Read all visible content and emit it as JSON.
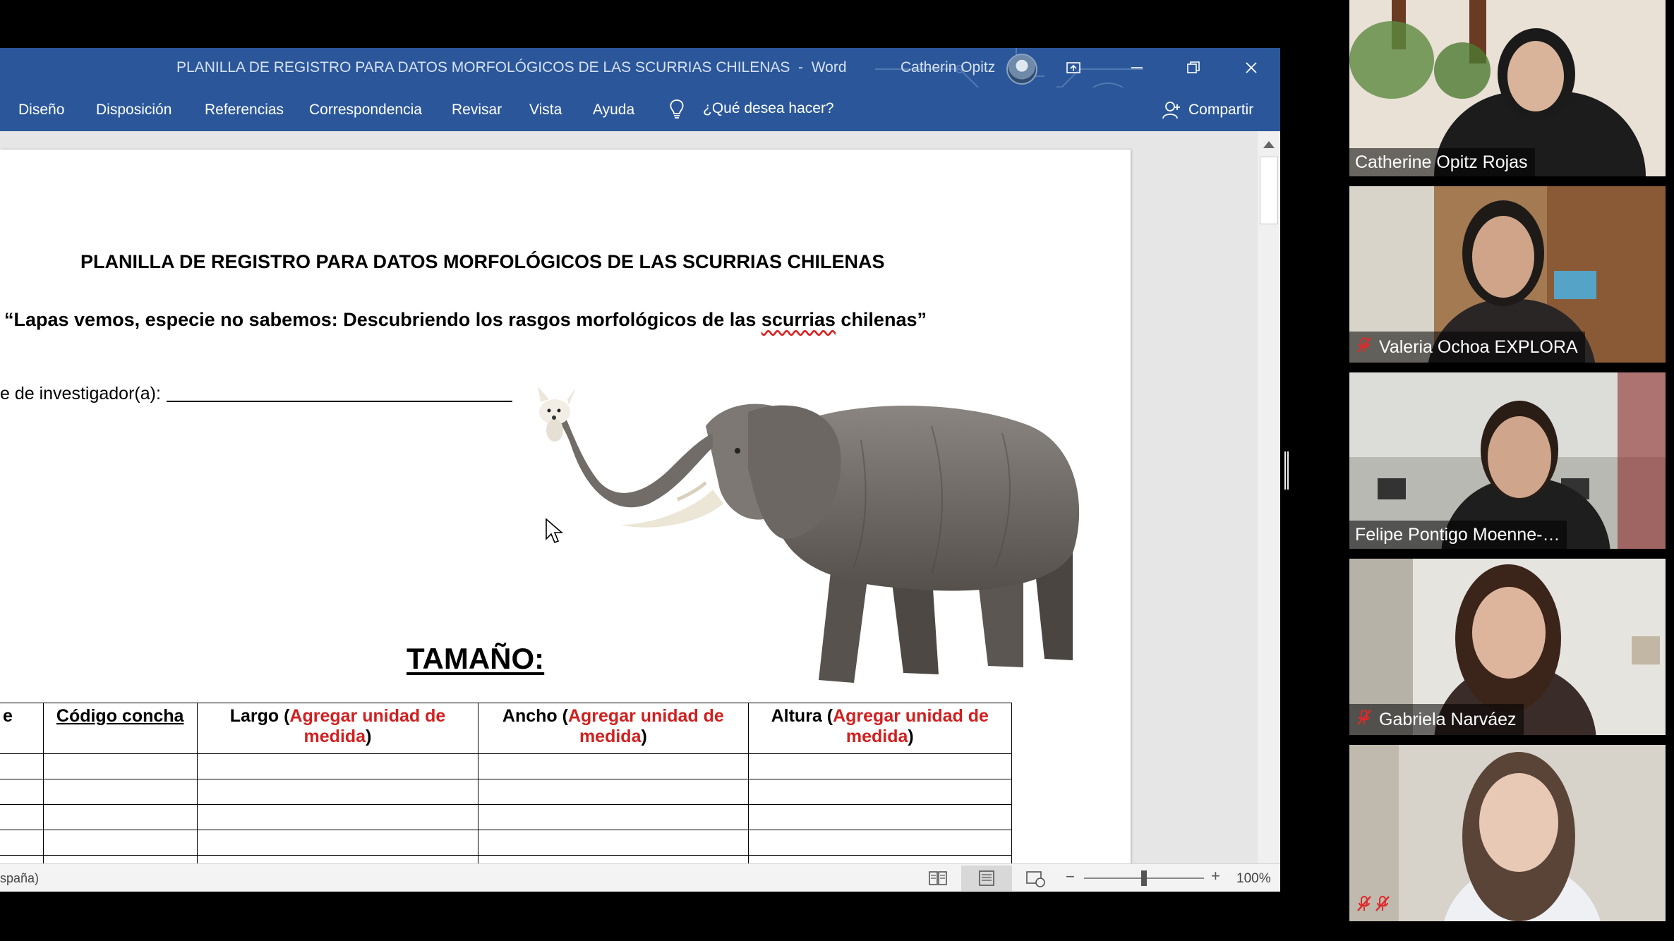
{
  "word": {
    "title": "PLANILLA DE REGISTRO PARA DATOS MORFOLÓGICOS DE LAS SCURRIAS CHILENAS  -  Word",
    "user_name": "Catherin Opitz",
    "menu": [
      "Diseño",
      "Disposición",
      "Referencias",
      "Correspondencia",
      "Revisar",
      "Vista",
      "Ayuda"
    ],
    "tell_me": "¿Qué desea hacer?",
    "share_label": "Compartir",
    "status_language": "spaña)",
    "zoom_minus": "−",
    "zoom_plus": "+",
    "zoom_level": "100%",
    "zoom_fraction": 0.5
  },
  "document": {
    "heading": "PLANILLA DE REGISTRO PARA DATOS MORFOLÓGICOS DE LAS SCURRIAS CHILENAS",
    "subtitle_before": "“Lapas vemos, especie no sabemos: Descubriendo los rasgos morfológicos de las ",
    "subtitle_spell": "scurrias",
    "subtitle_after": " chilenas”",
    "investigator_label": "e de investigador(a):",
    "section_title": "TAMAÑO:",
    "table": {
      "col0_fragment": "e",
      "col_code": "Código concha",
      "cols": [
        {
          "label": "Largo (",
          "red": "Agregar unidad de",
          "red2": "medida",
          "close": ")"
        },
        {
          "label": "Ancho (",
          "red": "Agregar unidad de",
          "red2": "medida",
          "close": ")"
        },
        {
          "label": "Altura (",
          "red": "Agregar unidad de",
          "red2": "medida",
          "close": ")"
        }
      ],
      "empty_rows": 6
    }
  },
  "participants": [
    {
      "name": "Catherine Opitz Rojas",
      "muted": false
    },
    {
      "name": "Valeria Ochoa EXPLORA",
      "muted": true
    },
    {
      "name": "Felipe Pontigo Moenne-…",
      "muted": false
    },
    {
      "name": "Gabriela Narváez",
      "muted": true
    },
    {
      "name": "",
      "muted": true
    }
  ],
  "colors": {
    "word_blue": "#2b579a",
    "required_red": "#d21f1f",
    "mute_red": "#e02828"
  }
}
